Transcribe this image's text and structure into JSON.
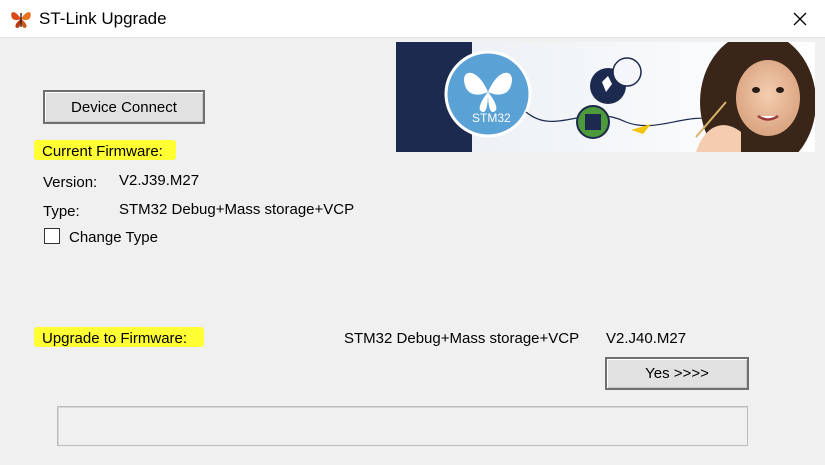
{
  "window": {
    "title": "ST-Link Upgrade",
    "icon": "butterfly-icon"
  },
  "banner": {
    "chip_text": "STM32"
  },
  "buttons": {
    "device_connect": "Device Connect",
    "yes": "Yes >>>>"
  },
  "current_firmware": {
    "heading": "Current Firmware:",
    "version_label": "Version:",
    "version_value": "V2.J39.M27",
    "type_label": "Type:",
    "type_value": "STM32 Debug+Mass storage+VCP",
    "change_type_label": "Change Type",
    "change_type_checked": false
  },
  "upgrade": {
    "heading": "Upgrade to Firmware:",
    "type_value": "STM32 Debug+Mass storage+VCP",
    "version_value": "V2.J40.M27"
  },
  "progress": {
    "percent": 0
  },
  "colors": {
    "highlight": "#ffff33",
    "banner_navy": "#1d2a4f",
    "circle_blue": "#5aa2d6"
  }
}
